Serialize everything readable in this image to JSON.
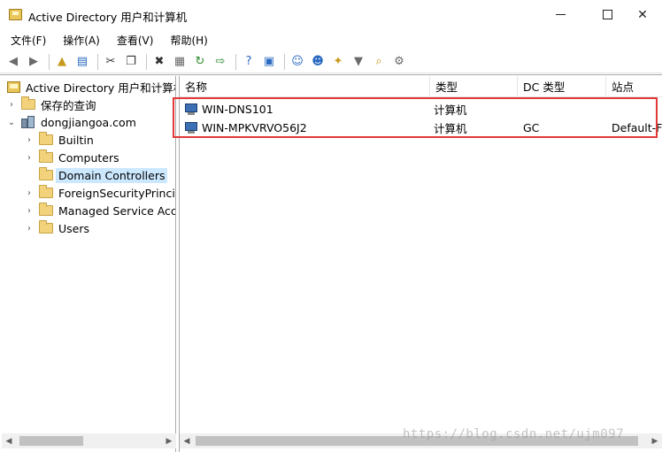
{
  "window": {
    "title": "Active Directory 用户和计算机",
    "min_glyph": "—",
    "max_glyph": "☐",
    "close_glyph": "✕"
  },
  "menu": {
    "items": [
      "文件(F)",
      "操作(A)",
      "查看(V)",
      "帮助(H)"
    ]
  },
  "toolbar": {
    "icons": [
      "back-arrow-icon",
      "forward-arrow-icon",
      "up-folder-icon",
      "show-pane-icon",
      "cut-icon",
      "copy-icon",
      "delete-icon",
      "properties-icon",
      "refresh-icon",
      "export-icon",
      "help-icon",
      "console-icon",
      "add-user-icon",
      "add-group-icon",
      "new-ou-icon",
      "filter-icon",
      "find-icon",
      "add-to-group-icon"
    ]
  },
  "tree": {
    "root": "Active Directory 用户和计算机",
    "saved_queries": "保存的查询",
    "domain": "dongjiangoa.com",
    "children": [
      "Builtin",
      "Computers",
      "Domain Controllers",
      "ForeignSecurityPrincipals",
      "Managed Service Accounts",
      "Users"
    ],
    "selected": "Domain Controllers"
  },
  "list": {
    "columns": [
      "名称",
      "类型",
      "DC 类型",
      "站点"
    ],
    "rows": [
      {
        "name": "WIN-DNS101",
        "type": "计算机",
        "dc_type": "",
        "site": ""
      },
      {
        "name": "WIN-MPKVRVO56J2",
        "type": "计算机",
        "dc_type": "GC",
        "site": "Default-First-Site-Name"
      }
    ]
  },
  "watermark": "https://blog.csdn.net/ujm097",
  "colors": {
    "highlight_border": "#e23838",
    "selection": "#cce8ff"
  }
}
